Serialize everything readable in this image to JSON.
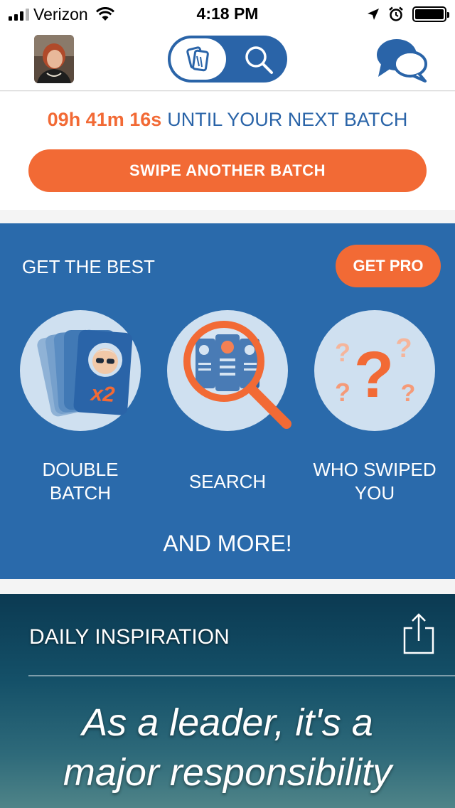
{
  "status_bar": {
    "carrier": "Verizon",
    "time": "4:18 PM"
  },
  "nav": {
    "avatar_alt": "profile photo",
    "cards_icon": "cards-icon",
    "search_icon": "search-icon",
    "chat_icon": "chat-bubbles-icon"
  },
  "countdown": {
    "time": "09h 41m 16s",
    "until_text": "UNTIL YOUR NEXT BATCH",
    "swipe_button": "SWIPE ANOTHER BATCH"
  },
  "pro": {
    "heading": "GET THE BEST",
    "button": "GET PRO",
    "features": [
      {
        "label_line1": "DOUBLE",
        "label_line2": "BATCH",
        "icon": "double-batch-icon"
      },
      {
        "label_line1": "SEARCH",
        "label_line2": "",
        "icon": "search-magnifier-icon"
      },
      {
        "label_line1": "WHO SWIPED",
        "label_line2": "YOU",
        "icon": "question-marks-icon"
      }
    ],
    "badge_x2": "x2",
    "and_more": "AND MORE!"
  },
  "inspiration": {
    "heading": "DAILY INSPIRATION",
    "quote_line1": "As a leader, it's a",
    "quote_line2": "major responsibility"
  },
  "colors": {
    "accent_orange": "#f26a35",
    "brand_blue": "#2a64a8",
    "panel_blue": "#2a6aab"
  }
}
